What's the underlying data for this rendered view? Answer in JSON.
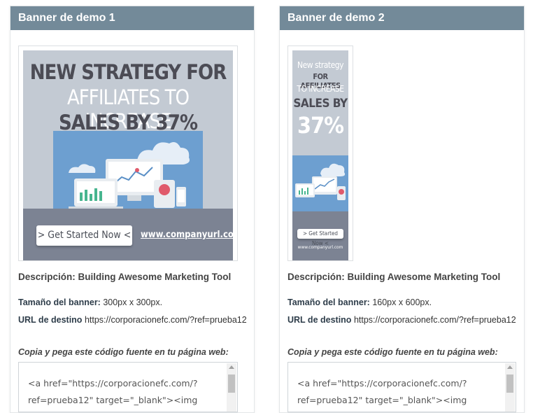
{
  "banners": [
    {
      "title": "Banner de demo 1",
      "headline": [
        "NEW STRATEGY FOR",
        "AFFILIATES TO INCREASE",
        "SALES BY 37%"
      ],
      "cta": "> Get Started Now <",
      "company_url": "www.companyurl.com",
      "description": "Descripción: Building Awesome Marketing Tool",
      "size_label": "Tamaño del banner:",
      "size_value": "300px x 300px.",
      "url_label": "URL de destino",
      "url_value": "https://corporacionefc.com/?ref=prueba12",
      "copy_label": "Copia y pega este código fuente en tu página web:",
      "code_lines": [
        "<a href=\"https://corporacionefc.com/?",
        "ref=prueba12\" target=\"_blank\"><img"
      ]
    },
    {
      "title": "Banner de demo 2",
      "headline": [
        "New strategy",
        "FOR AFFILIATES",
        "TO INCREASE",
        "SALES BY",
        "37%"
      ],
      "cta": "> Get Started Now <",
      "company_url": "www.companyurl.com",
      "description": "Descripción: Building Awesome Marketing Tool",
      "size_label": "Tamaño del banner:",
      "size_value": "160px x 600px.",
      "url_label": "URL de destino",
      "url_value": "https://corporacionefc.com/?ref=prueba12",
      "copy_label": "Copia y pega este código fuente en tu página web:",
      "code_lines": [
        "<a href=\"https://corporacionefc.com/?",
        "ref=prueba12\" target=\"_blank\"><img"
      ]
    }
  ],
  "colors": {
    "header_bg": "#738a99",
    "banner_bg": "#c3cad3",
    "banner_footer": "#7c8393",
    "scene_blue": "#6d9fd0"
  }
}
